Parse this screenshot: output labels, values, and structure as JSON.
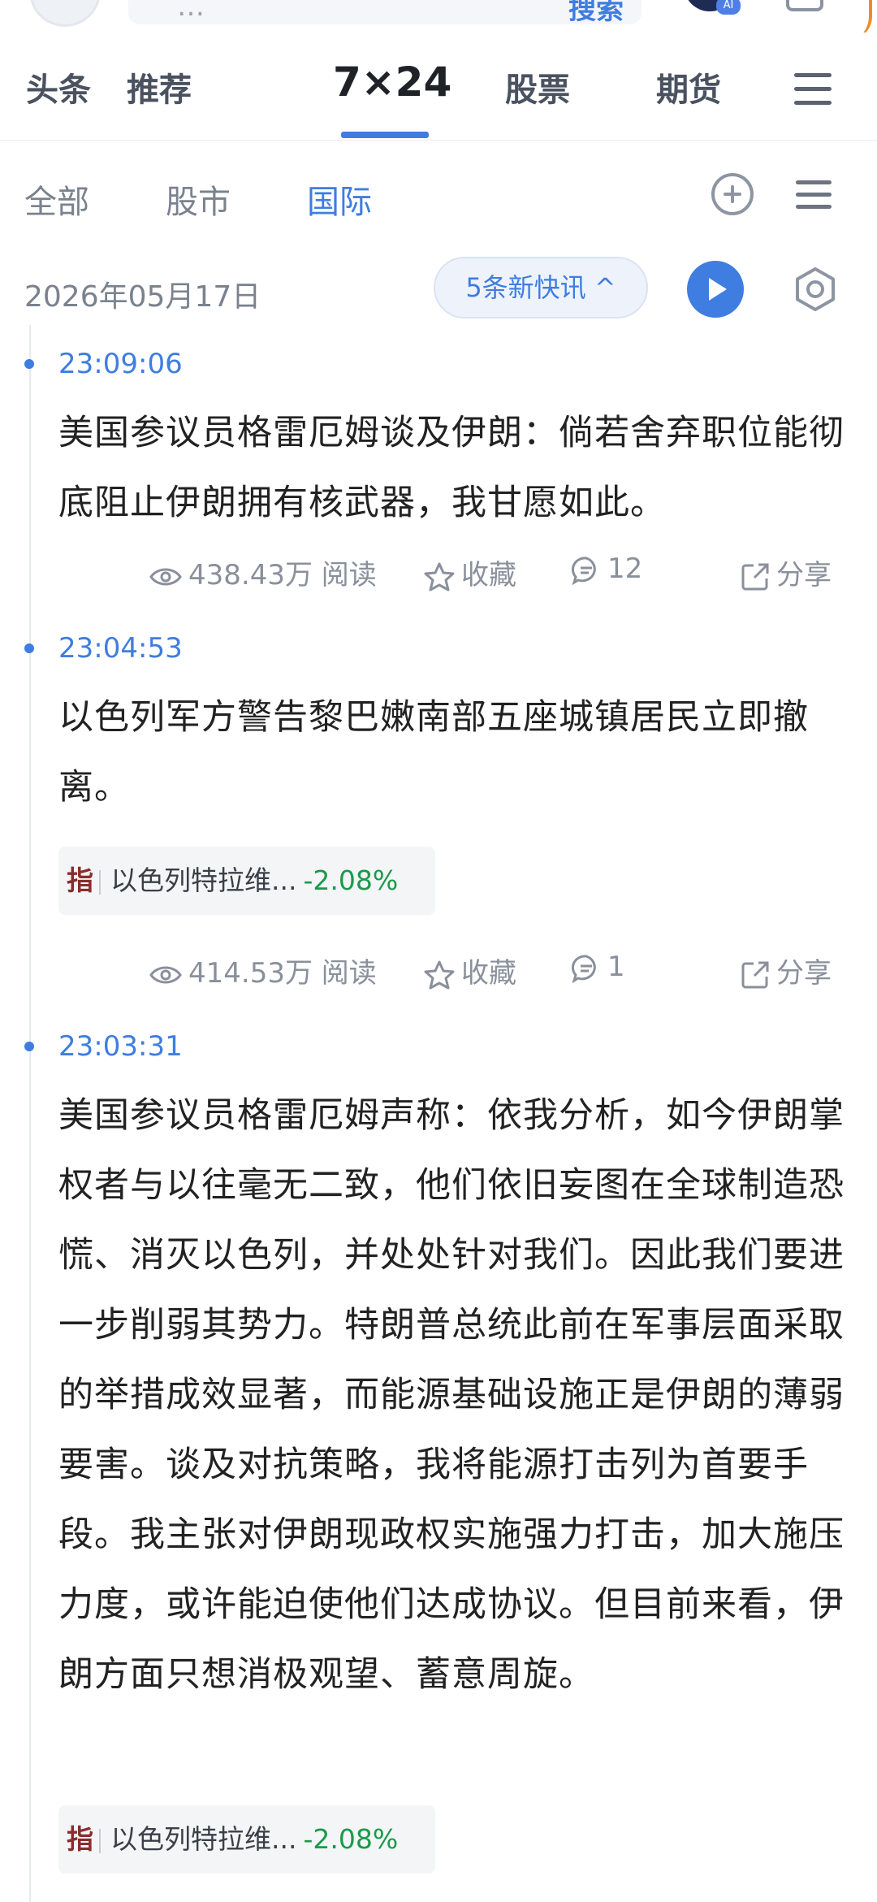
{
  "search": {
    "placeholder": "…",
    "button": "搜索"
  },
  "ai_badge": "AI",
  "nav": {
    "tabs": [
      "头条",
      "推荐",
      "7×24",
      "股票",
      "期货"
    ],
    "active": "7×24"
  },
  "sub_tabs": [
    "全部",
    "股市",
    "国际"
  ],
  "sub_tab_active": "国际",
  "date": "2026年05月17日",
  "new_pill": "5条新快讯 ^",
  "feed": [
    {
      "time": "23:09:06",
      "text": "美国参议员格雷厄姆谈及伊朗：倘若舍弃职位能彻底阻止伊朗拥有核武器，我甘愿如此。",
      "reads": "438.43万 阅读",
      "fav": "收藏",
      "comments": "12",
      "share": "分享"
    },
    {
      "time": "23:04:53",
      "text": "以色列军方警告黎巴嫩南部五座城镇居民立即撤离。",
      "tag": {
        "idx": "指",
        "name": "以色列特拉维...",
        "change": "-2.08%"
      },
      "reads": "414.53万 阅读",
      "fav": "收藏",
      "comments": "1",
      "share": "分享"
    },
    {
      "time": "23:03:31",
      "text": "美国参议员格雷厄姆声称：依我分析，如今伊朗掌权者与以往毫无二致，他们依旧妄图在全球制造恐慌、消灭以色列，并处处针对我们。因此我们要进一步削弱其势力。特朗普总统此前在军事层面采取的举措成效显著，而能源基础设施正是伊朗的薄弱要害。谈及对抗策略，我将能源打击列为首要手段。我主张对伊朗现政权实施强力打击，加大施压力度，或许能迫使他们达成协议。但目前来看，伊朗方面只想消极观望、蓄意周旋。",
      "tag": {
        "idx": "指",
        "name": "以色列特拉维...",
        "change": "-2.08%"
      }
    }
  ],
  "colors": {
    "accent": "#3f7de0",
    "down": "#1a9a4a",
    "text": "#222222"
  }
}
